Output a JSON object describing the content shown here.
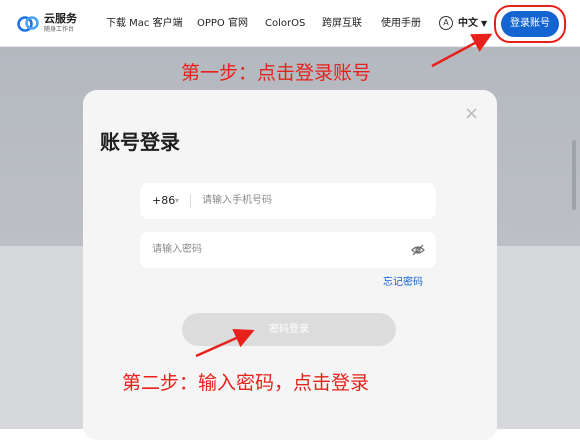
{
  "header": {
    "brand_name": "云服务",
    "brand_sub": "随身工作台",
    "nav": [
      "下载 Mac 客户端",
      "OPPO 官网",
      "ColorOS",
      "跨屏互联",
      "使用手册"
    ],
    "lang_icon": "A",
    "lang_label": "中文",
    "lang_caret": "▼",
    "login_button": "登录账号"
  },
  "annotations": {
    "step1": "第一步：点击登录账号",
    "step2": "第二步：输入密码，点击登录"
  },
  "modal": {
    "close_glyph": "×",
    "title": "账号登录",
    "country_code": "+86",
    "country_caret": "▾",
    "phone_placeholder": "请输入手机号码",
    "password_placeholder": "请输入密码",
    "forgot_password": "忘记密码",
    "submit": "密码登录"
  },
  "icons": {
    "logo": "cloud-logo-icon",
    "language": "language-icon",
    "close": "close-icon",
    "password_visibility": "eye-off-icon"
  },
  "colors": {
    "primary": "#1464d2",
    "annotation": "#e8211c",
    "disabled_button": "#dcdcdc"
  }
}
